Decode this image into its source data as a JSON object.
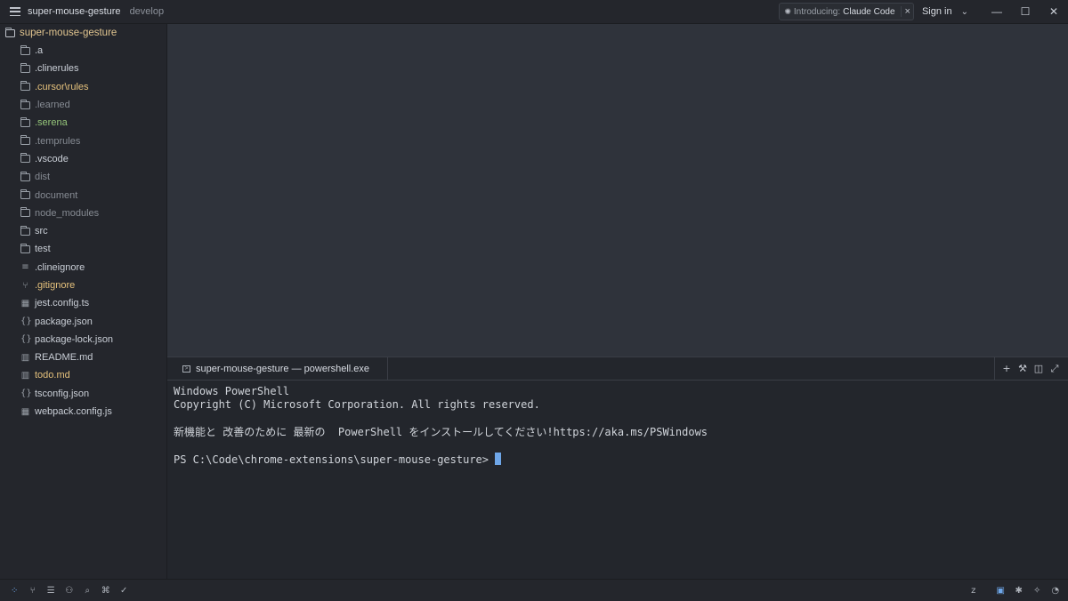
{
  "titlebar": {
    "project_name": "super-mouse-gesture",
    "branch": "develop",
    "notice_intro": "Introducing:",
    "notice_product": "Claude Code",
    "notice_close": "×",
    "sign_in": "Sign in"
  },
  "sidebar": {
    "root": "super-mouse-gesture",
    "items": [
      {
        "label": ".a",
        "type": "folder",
        "color": "normal"
      },
      {
        "label": ".clinerules",
        "type": "folder",
        "color": "normal"
      },
      {
        "label": ".cursor\\rules",
        "type": "folder",
        "color": "yellow"
      },
      {
        "label": ".learned",
        "type": "folder",
        "color": "dim"
      },
      {
        "label": ".serena",
        "type": "folder",
        "color": "green"
      },
      {
        "label": ".temprules",
        "type": "folder",
        "color": "dim"
      },
      {
        "label": ".vscode",
        "type": "folder",
        "color": "normal"
      },
      {
        "label": "dist",
        "type": "folder",
        "color": "dim"
      },
      {
        "label": "document",
        "type": "folder",
        "color": "dim"
      },
      {
        "label": "node_modules",
        "type": "folder",
        "color": "dim"
      },
      {
        "label": "src",
        "type": "folder",
        "color": "normal"
      },
      {
        "label": "test",
        "type": "folder",
        "color": "normal"
      },
      {
        "label": ".clineignore",
        "type": "lines-icon",
        "color": "normal"
      },
      {
        "label": ".gitignore",
        "type": "git-icon",
        "color": "yellow"
      },
      {
        "label": "jest.config.ts",
        "type": "ts-icon",
        "color": "normal"
      },
      {
        "label": "package.json",
        "type": "json-icon",
        "color": "normal"
      },
      {
        "label": "package-lock.json",
        "type": "json-icon",
        "color": "normal"
      },
      {
        "label": "README.md",
        "type": "book-icon",
        "color": "normal"
      },
      {
        "label": "todo.md",
        "type": "book-icon",
        "color": "yellow"
      },
      {
        "label": "tsconfig.json",
        "type": "json-icon",
        "color": "normal"
      },
      {
        "label": "webpack.config.js",
        "type": "js-icon",
        "color": "normal"
      }
    ]
  },
  "terminal": {
    "tab_title": "super-mouse-gesture — powershell.exe",
    "lines": [
      "Windows PowerShell",
      "Copyright (C) Microsoft Corporation. All rights reserved.",
      "",
      "新機能と 改善のために 最新の  PowerShell をインストールしてください!https://aka.ms/PSWindows",
      "",
      "PS C:\\Code\\chrome-extensions\\super-mouse-gesture>"
    ]
  },
  "colors": {
    "accent": "#6ea6e8",
    "modified_yellow": "#e5c17c",
    "untracked_green": "#95c57a",
    "ignored_dim": "#868b93"
  }
}
